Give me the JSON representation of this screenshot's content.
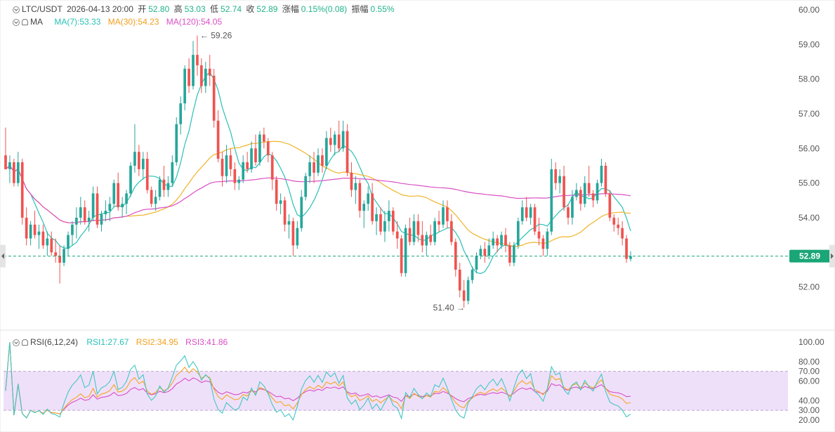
{
  "header": {
    "symbol": "LTC/USDT",
    "datetime": "2026-04-13 20:00",
    "open_label": "开",
    "open_value": "52.80",
    "high_label": "高",
    "high_value": "53.03",
    "low_label": "低",
    "low_value": "52.74",
    "close_label": "收",
    "close_value": "52.89",
    "change_label": "涨幅",
    "change_value": "0.15%(0.08)",
    "amplitude_label": "振幅",
    "amplitude_value": "0.55%"
  },
  "ma_legend": {
    "label": "MA",
    "ma7": "MA(7):53.33",
    "ma30": "MA(30):54.23",
    "ma120": "MA(120):54.05"
  },
  "rsi_legend": {
    "label": "RSI(6,12,24)",
    "rsi1": "RSI1:27.67",
    "rsi2": "RSI2:34.95",
    "rsi3": "RSI3:41.86"
  },
  "colors": {
    "up": "#26a69a",
    "down": "#ef5350",
    "ma7": "#29c1b5",
    "ma30": "#f0b429",
    "ma120": "#d94fc4",
    "rsi1": "#40c8c0",
    "rsi2": "#f5a623",
    "rsi3": "#d94fc4",
    "rsi_band": "#efe0fa",
    "price_tag": "#1aa676"
  },
  "icons": [
    "chevron-toggle-icon",
    "bell-icon",
    "left-arrow-icon",
    "right-arrow-icon"
  ],
  "chart_data": {
    "type": "candlestick",
    "price_axis": {
      "ticks": [
        "60.00",
        "59.00",
        "58.00",
        "57.00",
        "56.00",
        "55.00",
        "54.00",
        "52.00"
      ],
      "ylim": [
        51.2,
        60.0
      ]
    },
    "rsi_axis": {
      "ticks": [
        "100.00",
        "80.00",
        "70.00",
        "60.00",
        "40.00",
        "30.00",
        "20.00"
      ],
      "ylim": [
        20,
        100
      ],
      "band": [
        30,
        70
      ]
    },
    "last_price": "52.89",
    "high_marker": "59.26",
    "low_marker": "51.40",
    "candles": [
      [
        55.8,
        56.6,
        55.4,
        55.4
      ],
      [
        55.4,
        55.8,
        55.0,
        55.6
      ],
      [
        55.6,
        55.7,
        54.9,
        55.0
      ],
      [
        55.0,
        55.9,
        54.9,
        55.6
      ],
      [
        55.6,
        55.7,
        53.8,
        54.0
      ],
      [
        54.0,
        54.3,
        53.2,
        53.4
      ],
      [
        53.4,
        53.9,
        53.2,
        53.8
      ],
      [
        53.8,
        54.2,
        53.4,
        53.5
      ],
      [
        53.5,
        53.8,
        53.1,
        53.6
      ],
      [
        53.6,
        53.8,
        53.1,
        53.2
      ],
      [
        53.2,
        53.6,
        52.9,
        53.4
      ],
      [
        53.4,
        53.6,
        52.9,
        53.0
      ],
      [
        53.0,
        53.4,
        52.7,
        52.9
      ],
      [
        52.9,
        53.2,
        52.1,
        52.7
      ],
      [
        52.7,
        53.2,
        52.6,
        53.1
      ],
      [
        53.1,
        53.6,
        52.9,
        53.5
      ],
      [
        53.5,
        53.9,
        53.2,
        53.8
      ],
      [
        53.8,
        54.3,
        53.4,
        54.0
      ],
      [
        54.0,
        54.6,
        53.8,
        54.3
      ],
      [
        54.3,
        54.5,
        53.8,
        53.9
      ],
      [
        53.9,
        54.2,
        53.6,
        54.0
      ],
      [
        54.0,
        54.9,
        53.9,
        54.7
      ],
      [
        54.7,
        54.9,
        53.7,
        53.8
      ],
      [
        53.8,
        54.2,
        53.6,
        54.1
      ],
      [
        54.1,
        54.5,
        53.9,
        54.2
      ],
      [
        54.2,
        54.6,
        53.9,
        54.4
      ],
      [
        54.4,
        55.1,
        54.3,
        55.0
      ],
      [
        55.0,
        55.3,
        54.2,
        54.3
      ],
      [
        54.3,
        54.6,
        54.0,
        54.4
      ],
      [
        54.4,
        54.8,
        54.1,
        54.7
      ],
      [
        54.7,
        55.6,
        54.6,
        55.5
      ],
      [
        55.5,
        56.7,
        55.3,
        55.9
      ],
      [
        55.9,
        56.1,
        55.2,
        55.4
      ],
      [
        55.4,
        55.9,
        55.1,
        55.7
      ],
      [
        55.7,
        55.9,
        54.7,
        54.8
      ],
      [
        54.8,
        54.9,
        54.3,
        54.4
      ],
      [
        54.4,
        54.8,
        54.2,
        54.6
      ],
      [
        54.6,
        55.2,
        54.5,
        55.1
      ],
      [
        55.1,
        55.5,
        54.6,
        54.8
      ],
      [
        54.8,
        55.2,
        54.6,
        55.0
      ],
      [
        55.0,
        55.8,
        54.9,
        55.6
      ],
      [
        55.6,
        56.9,
        55.5,
        56.7
      ],
      [
        56.7,
        57.5,
        56.4,
        57.3
      ],
      [
        57.3,
        58.4,
        57.1,
        58.3
      ],
      [
        58.3,
        58.6,
        57.6,
        57.8
      ],
      [
        57.8,
        59.1,
        57.7,
        58.7
      ],
      [
        58.7,
        59.26,
        58.1,
        58.4
      ],
      [
        58.4,
        58.6,
        57.6,
        57.8
      ],
      [
        57.8,
        58.5,
        57.6,
        58.3
      ],
      [
        58.3,
        58.7,
        57.8,
        58.1
      ],
      [
        58.1,
        58.3,
        56.6,
        56.8
      ],
      [
        56.8,
        57.1,
        55.6,
        55.7
      ],
      [
        55.7,
        55.9,
        54.9,
        55.2
      ],
      [
        55.2,
        56.1,
        55.0,
        55.8
      ],
      [
        55.8,
        56.0,
        55.2,
        55.4
      ],
      [
        55.4,
        55.6,
        54.8,
        55.0
      ],
      [
        55.0,
        55.2,
        54.8,
        55.1
      ],
      [
        55.1,
        55.8,
        55.0,
        55.6
      ],
      [
        55.6,
        55.9,
        55.3,
        55.4
      ],
      [
        55.4,
        56.2,
        55.3,
        56.0
      ],
      [
        56.0,
        56.4,
        55.5,
        55.6
      ],
      [
        55.6,
        56.5,
        55.5,
        56.4
      ],
      [
        56.4,
        56.6,
        56.0,
        56.2
      ],
      [
        56.2,
        56.3,
        55.6,
        55.8
      ],
      [
        55.8,
        55.9,
        54.8,
        55.1
      ],
      [
        55.1,
        55.2,
        54.2,
        54.4
      ],
      [
        54.4,
        54.7,
        54.1,
        54.5
      ],
      [
        54.5,
        54.6,
        53.6,
        53.8
      ],
      [
        53.8,
        54.1,
        53.4,
        53.9
      ],
      [
        53.9,
        54.0,
        52.9,
        53.2
      ],
      [
        53.2,
        53.9,
        53.1,
        53.7
      ],
      [
        53.7,
        54.8,
        53.6,
        54.6
      ],
      [
        54.6,
        55.3,
        54.5,
        55.2
      ],
      [
        55.2,
        55.8,
        55.0,
        55.6
      ],
      [
        55.6,
        55.9,
        55.0,
        55.3
      ],
      [
        55.3,
        56.0,
        55.2,
        55.8
      ],
      [
        55.8,
        56.0,
        55.3,
        55.5
      ],
      [
        55.5,
        56.5,
        55.4,
        56.3
      ],
      [
        56.3,
        56.6,
        55.9,
        56.1
      ],
      [
        56.1,
        56.5,
        55.8,
        56.4
      ],
      [
        56.4,
        56.8,
        55.9,
        56.0
      ],
      [
        56.0,
        56.8,
        55.9,
        56.5
      ],
      [
        56.5,
        56.7,
        55.2,
        55.3
      ],
      [
        55.3,
        55.6,
        54.6,
        54.8
      ],
      [
        54.8,
        55.2,
        54.4,
        55.0
      ],
      [
        55.0,
        55.1,
        54.0,
        54.2
      ],
      [
        54.2,
        54.5,
        53.7,
        54.4
      ],
      [
        54.4,
        54.9,
        54.2,
        54.7
      ],
      [
        54.7,
        55.0,
        53.8,
        53.9
      ],
      [
        53.9,
        54.3,
        53.5,
        54.1
      ],
      [
        54.1,
        54.3,
        53.5,
        53.6
      ],
      [
        53.6,
        54.2,
        53.3,
        53.9
      ],
      [
        53.9,
        54.5,
        53.6,
        54.2
      ],
      [
        54.2,
        54.3,
        53.5,
        53.6
      ],
      [
        53.6,
        53.9,
        53.1,
        53.4
      ],
      [
        53.4,
        53.5,
        52.3,
        52.4
      ],
      [
        52.4,
        53.8,
        52.3,
        53.7
      ],
      [
        53.7,
        54.0,
        53.2,
        53.3
      ],
      [
        53.3,
        54.1,
        53.2,
        53.9
      ],
      [
        53.9,
        54.1,
        53.3,
        53.5
      ],
      [
        53.5,
        53.9,
        53.0,
        53.2
      ],
      [
        53.2,
        53.6,
        52.9,
        53.5
      ],
      [
        53.5,
        53.8,
        53.2,
        53.3
      ],
      [
        53.3,
        54.0,
        53.2,
        53.9
      ],
      [
        53.9,
        54.2,
        53.6,
        53.8
      ],
      [
        53.8,
        54.5,
        53.7,
        54.3
      ],
      [
        54.3,
        54.5,
        53.7,
        53.9
      ],
      [
        53.9,
        54.1,
        53.2,
        53.3
      ],
      [
        53.3,
        53.4,
        52.3,
        52.5
      ],
      [
        52.5,
        52.7,
        51.7,
        51.9
      ],
      [
        51.9,
        52.2,
        51.4,
        51.6
      ],
      [
        51.6,
        52.3,
        51.5,
        52.2
      ],
      [
        52.2,
        52.6,
        52.1,
        52.5
      ],
      [
        52.5,
        53.0,
        52.4,
        52.9
      ],
      [
        52.9,
        53.2,
        52.8,
        53.1
      ],
      [
        53.1,
        53.3,
        52.7,
        52.9
      ],
      [
        52.9,
        53.4,
        52.8,
        53.2
      ],
      [
        53.2,
        53.6,
        53.1,
        53.4
      ],
      [
        53.4,
        53.5,
        53.0,
        53.2
      ],
      [
        53.2,
        53.6,
        53.1,
        53.5
      ],
      [
        53.5,
        53.7,
        53.0,
        53.2
      ],
      [
        53.2,
        53.3,
        52.6,
        52.7
      ],
      [
        52.7,
        53.3,
        52.6,
        53.2
      ],
      [
        53.2,
        54.0,
        53.1,
        53.9
      ],
      [
        53.9,
        54.5,
        53.8,
        54.3
      ],
      [
        54.3,
        54.6,
        53.9,
        54.0
      ],
      [
        54.0,
        54.4,
        53.8,
        54.3
      ],
      [
        54.3,
        54.4,
        53.5,
        53.6
      ],
      [
        53.6,
        54.0,
        53.2,
        53.4
      ],
      [
        53.4,
        53.5,
        52.9,
        53.1
      ],
      [
        53.1,
        53.7,
        52.9,
        53.6
      ],
      [
        53.6,
        55.7,
        53.5,
        55.4
      ],
      [
        55.4,
        55.6,
        54.8,
        55.0
      ],
      [
        55.0,
        55.4,
        54.7,
        55.2
      ],
      [
        55.2,
        55.5,
        54.2,
        54.3
      ],
      [
        54.3,
        54.4,
        53.8,
        54.0
      ],
      [
        54.0,
        54.8,
        53.8,
        54.6
      ],
      [
        54.6,
        55.0,
        54.5,
        54.8
      ],
      [
        54.8,
        54.9,
        54.2,
        54.4
      ],
      [
        54.4,
        55.2,
        54.3,
        55.0
      ],
      [
        55.0,
        55.5,
        54.6,
        54.7
      ],
      [
        54.7,
        54.8,
        54.3,
        54.5
      ],
      [
        54.5,
        55.1,
        54.4,
        55.0
      ],
      [
        55.0,
        55.7,
        54.9,
        55.5
      ],
      [
        55.5,
        55.6,
        54.6,
        54.7
      ],
      [
        54.7,
        54.8,
        53.9,
        54.0
      ],
      [
        54.0,
        54.1,
        53.6,
        53.8
      ],
      [
        53.8,
        54.0,
        53.5,
        53.7
      ],
      [
        53.7,
        53.9,
        53.2,
        53.4
      ],
      [
        53.4,
        53.5,
        52.7,
        52.81
      ],
      [
        52.81,
        53.03,
        52.74,
        52.89
      ]
    ],
    "ma_series": [
      {
        "name": "MA(7)",
        "period": 7
      },
      {
        "name": "MA(30)",
        "period": 30
      },
      {
        "name": "MA(120)",
        "period": 120
      }
    ],
    "rsi_series": [
      {
        "name": "RSI1",
        "period": 6
      },
      {
        "name": "RSI2",
        "period": 12
      },
      {
        "name": "RSI3",
        "period": 24
      }
    ]
  }
}
